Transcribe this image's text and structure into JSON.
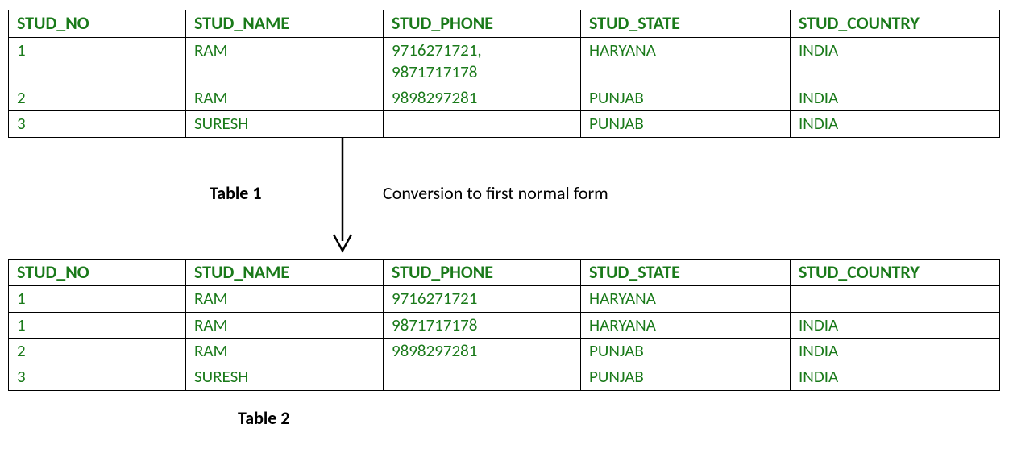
{
  "headers": {
    "stud_no": "STUD_NO",
    "stud_name": "STUD_NAME",
    "stud_phone": "STUD_PHONE",
    "stud_state": "STUD_STATE",
    "stud_country": "STUD_COUNTRY"
  },
  "table1": {
    "label": "Table 1",
    "rows": [
      {
        "no": "1",
        "name": "RAM",
        "phone": "9716271721,\n9871717178",
        "state": "HARYANA",
        "country": "INDIA"
      },
      {
        "no": "2",
        "name": "RAM",
        "phone": "9898297281",
        "state": "PUNJAB",
        "country": "INDIA"
      },
      {
        "no": "3",
        "name": "SURESH",
        "phone": "",
        "state": "PUNJAB",
        "country": "INDIA"
      }
    ]
  },
  "conversion_text": "Conversion to first normal form",
  "table2": {
    "label": "Table 2",
    "rows": [
      {
        "no": "1",
        "name": "RAM",
        "phone": "9716271721",
        "state": "HARYANA",
        "country": ""
      },
      {
        "no": "1",
        "name": "RAM",
        "phone": "9871717178",
        "state": "HARYANA",
        "country": "INDIA"
      },
      {
        "no": "2",
        "name": "RAM",
        "phone": "9898297281",
        "state": "PUNJAB",
        "country": "INDIA"
      },
      {
        "no": "3",
        "name": "SURESH",
        "phone": "",
        "state": "PUNJAB",
        "country": "INDIA"
      }
    ]
  }
}
